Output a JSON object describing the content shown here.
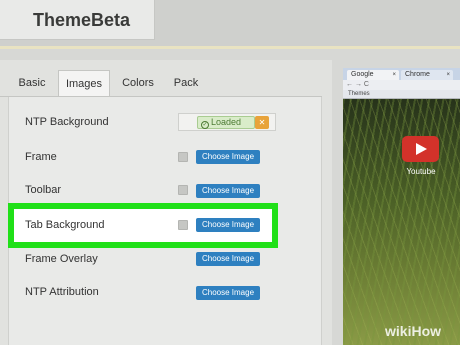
{
  "header": {
    "brand": "ThemeBeta"
  },
  "tabs": [
    "Basic",
    "Images",
    "Colors",
    "Pack"
  ],
  "active_tab": "Images",
  "rows": [
    {
      "label": "NTP Background",
      "status": "Loaded",
      "remove_icon": "x-icon"
    },
    {
      "label": "Frame",
      "button": "Choose Image"
    },
    {
      "label": "Toolbar",
      "button": "Choose Image"
    },
    {
      "label": "Tab Background",
      "button": "Choose Image",
      "highlighted": true
    },
    {
      "label": "Frame Overlay",
      "button": "Choose Image"
    },
    {
      "label": "NTP Attribution",
      "button": "Choose Image"
    }
  ],
  "preview": {
    "tab1": "Google",
    "tab2": "Chrome",
    "bookmark": "Themes",
    "app_label": "Youtube"
  },
  "watermark": "wikiHow",
  "colors": {
    "highlight": "#20e018",
    "button": "#2e80c0",
    "loaded_bg": "#d9ecc9",
    "remove": "#e8a33a"
  }
}
